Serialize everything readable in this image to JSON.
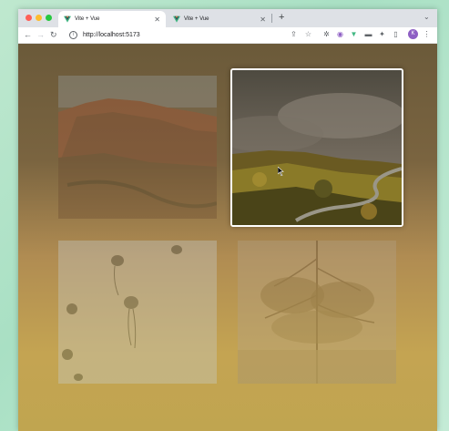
{
  "browser": {
    "tabs": [
      {
        "title": "Vite + Vue",
        "active": true
      },
      {
        "title": "Vite + Vue",
        "active": false
      }
    ],
    "new_tab_label": "+",
    "url": "http://localhost:5173",
    "profile_initial": "K"
  },
  "colors": {
    "traffic_red": "#ff5f57",
    "traffic_yellow": "#febc2e",
    "traffic_green": "#28c840",
    "page_bg_top": "#6b5a3a",
    "page_bg_bottom": "#c0a550",
    "selection_border": "#ffffff"
  },
  "gallery": {
    "images": [
      {
        "subject": "red rock canyon",
        "state": "dimmed"
      },
      {
        "subject": "misty hillside with winding road",
        "state": "selected"
      },
      {
        "subject": "jellyfish",
        "state": "dimmed"
      },
      {
        "subject": "tree reflection",
        "state": "dimmed"
      }
    ]
  }
}
